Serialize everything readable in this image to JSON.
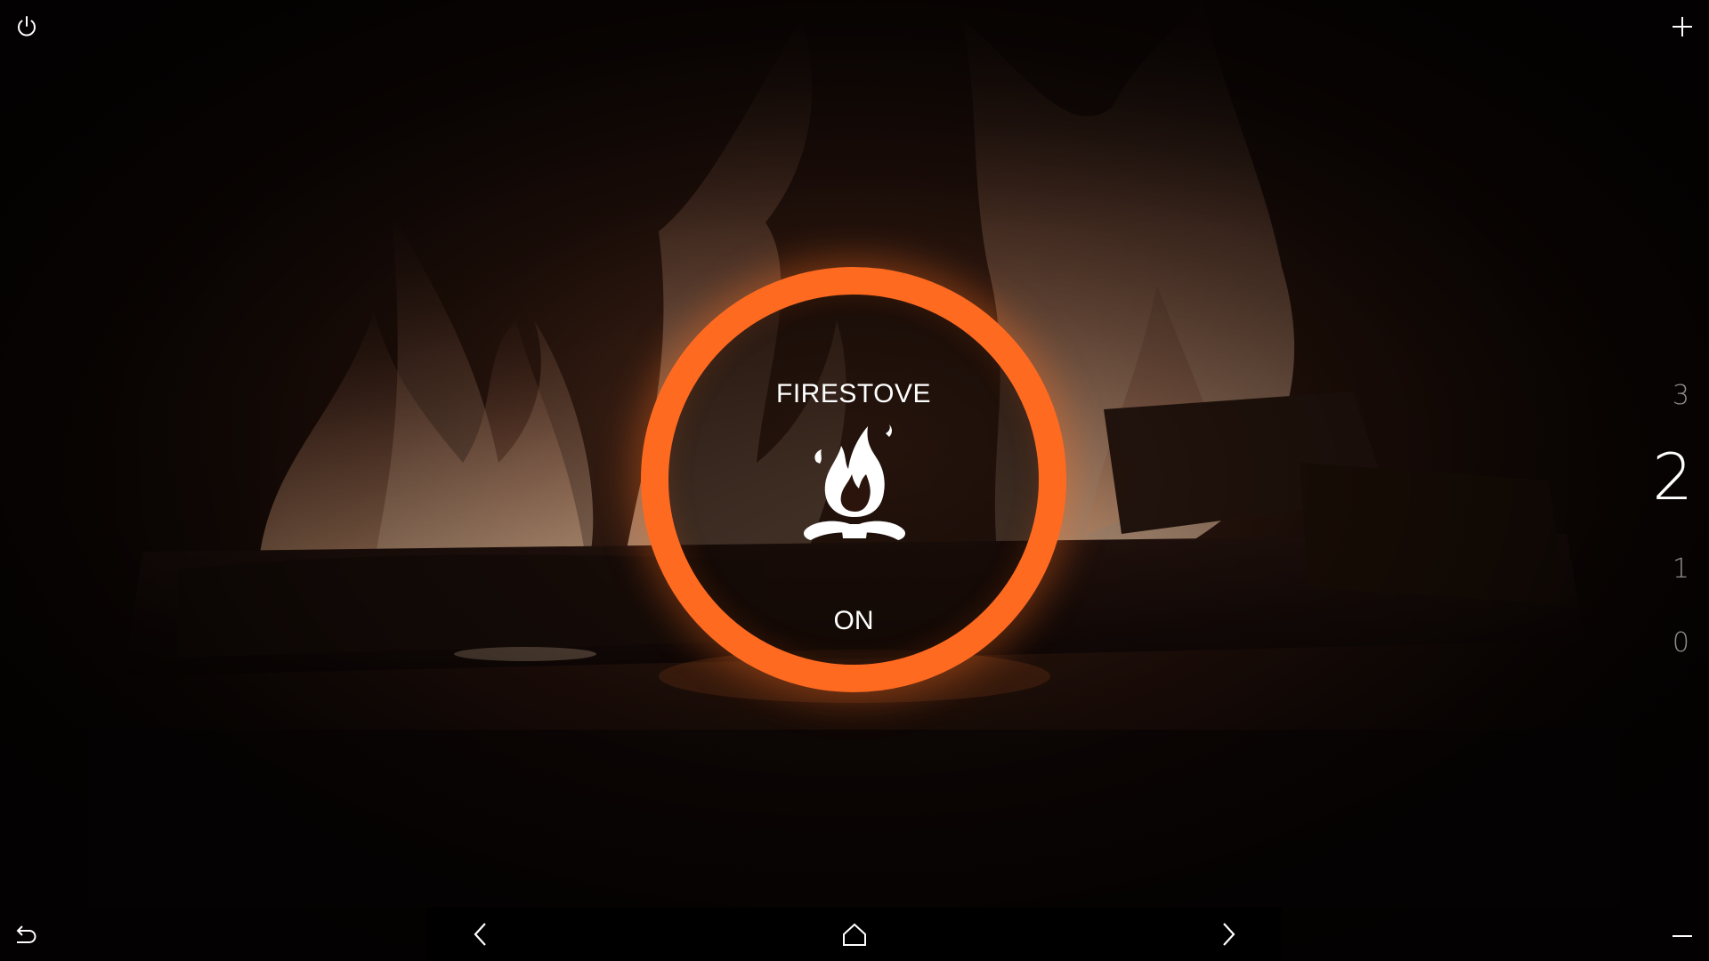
{
  "device": {
    "title": "FIRESTOVE",
    "state": "ON"
  },
  "levels": {
    "options": [
      "3",
      "2",
      "1",
      "0"
    ],
    "selected": "2"
  },
  "controls": {
    "power_icon": "power-icon",
    "increase_icon": "plus-icon",
    "decrease_icon": "minus-icon",
    "back_icon": "undo-arrow-icon"
  },
  "navbar": {
    "prev_icon": "chevron-left-icon",
    "home_icon": "home-icon",
    "next_icon": "chevron-right-icon"
  },
  "colors": {
    "accent": "#ff6a21",
    "text": "#ffffff",
    "background": "#0d0605"
  }
}
